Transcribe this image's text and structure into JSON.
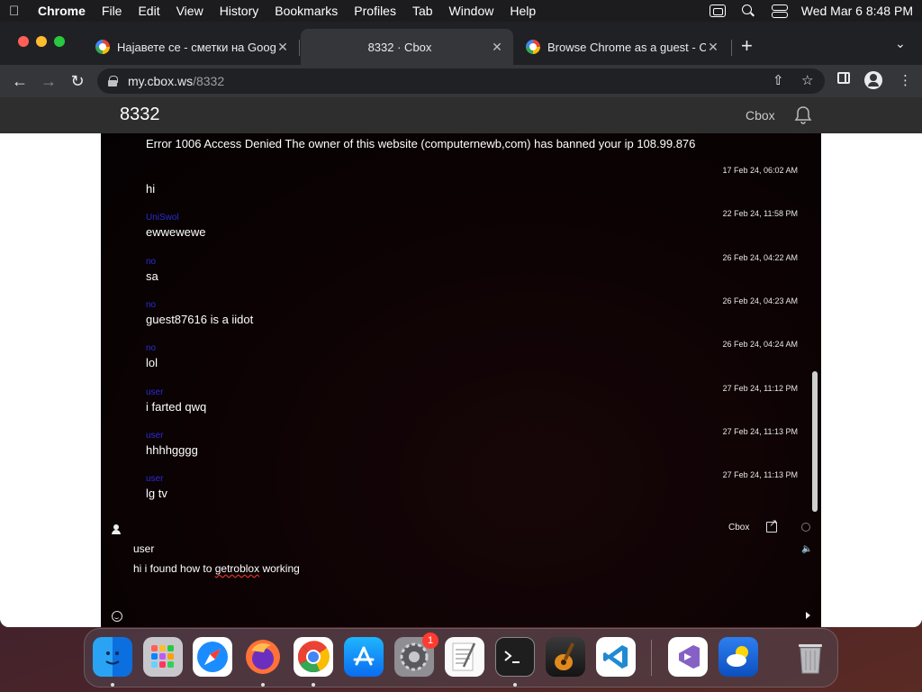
{
  "menubar": {
    "apple": "",
    "app_name": "Chrome",
    "items": [
      "File",
      "Edit",
      "View",
      "History",
      "Bookmarks",
      "Profiles",
      "Tab",
      "Window",
      "Help"
    ],
    "clock": "Wed Mar 6  8:48 PM"
  },
  "tabs": [
    {
      "title": "Најавете се - сметки на Goog",
      "close": "✕"
    },
    {
      "title": "8332 · Cbox",
      "close": "✕"
    },
    {
      "title": "Browse Chrome as a guest - Co",
      "close": "✕"
    }
  ],
  "toolbar": {
    "url_host": "my.cbox.ws",
    "url_path": "/8332",
    "new_tab": "+",
    "tab_menu": "⌄"
  },
  "site": {
    "title": "8332",
    "brand": "Cbox"
  },
  "messages": [
    {
      "name": "",
      "time": "",
      "text": "Error 1006 Access Denied The owner of this website (computernewb,com) has banned your ip 108.99.876"
    },
    {
      "name": "",
      "time": "17 Feb 24, 06:02 AM",
      "text": "hi"
    },
    {
      "name": "UniSwol",
      "time": "22 Feb 24, 11:58 PM",
      "text": "ewwewewe"
    },
    {
      "name": "no",
      "time": "26 Feb 24, 04:22 AM",
      "text": "sa"
    },
    {
      "name": "no",
      "time": "26 Feb 24, 04:23 AM",
      "text": "guest87616 is a iidot"
    },
    {
      "name": "no",
      "time": "26 Feb 24, 04:24 AM",
      "text": "lol"
    },
    {
      "name": "user",
      "time": "27 Feb 24, 11:12 PM",
      "text": "i farted qwq"
    },
    {
      "name": "user",
      "time": "27 Feb 24, 11:13 PM",
      "text": "hhhhgggg"
    },
    {
      "name": "user",
      "time": "27 Feb 24, 11:13 PM",
      "text": "lg tv"
    }
  ],
  "compose": {
    "brand": "Cbox",
    "name_value": "user",
    "message_before": "hi i found how to ",
    "message_misspelled": "getroblox",
    "message_after": " working"
  },
  "dock": {
    "badge": "1",
    "apps": [
      "finder-icon",
      "launchpad-icon",
      "safari-icon",
      "firefox-icon",
      "chrome-icon",
      "app-store-icon",
      "system-settings-icon",
      "textedit-icon",
      "terminal-icon",
      "garageband-icon",
      "vscode-icon",
      "visual-studio-icon",
      "weather-icon",
      "trash-icon"
    ]
  },
  "colors": {
    "chat_bg": "#0b0203",
    "username": "#2c2cd8",
    "chrome_dark": "#202124",
    "chrome_toolbar": "#35363a"
  }
}
